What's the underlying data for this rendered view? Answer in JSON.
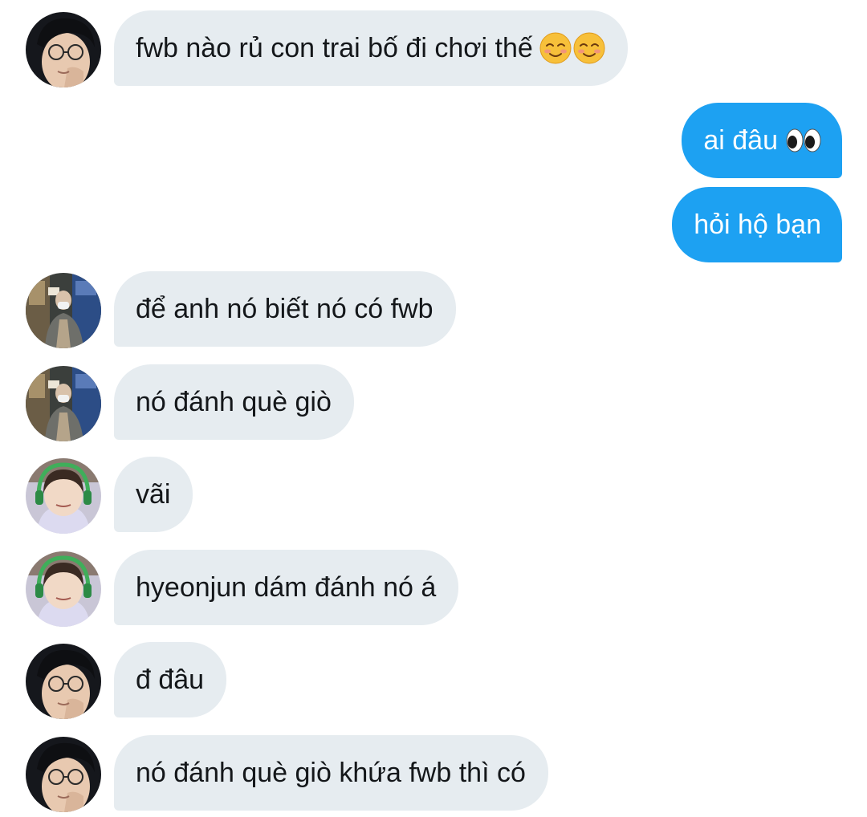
{
  "conversation": {
    "messages": [
      {
        "side": "in",
        "text": "fwb nào rủ con trai bố đi chơi thế",
        "emoji": [
          "smiling-face-icon",
          "smiling-face-icon"
        ],
        "avatar": "avatar-glasses"
      },
      {
        "side": "out",
        "text": "ai đâu",
        "emoji": [
          "eyes-icon"
        ]
      },
      {
        "side": "out",
        "text": "hỏi hộ bạn"
      },
      {
        "side": "in",
        "text": "để anh nó biết nó có fwb",
        "avatar": "avatar-mask-store"
      },
      {
        "side": "in",
        "text": "nó đánh què giò",
        "avatar": "avatar-mask-store"
      },
      {
        "side": "in",
        "text": "vãi",
        "avatar": "avatar-headset"
      },
      {
        "side": "in",
        "text": "hyeonjun dám đánh nó á",
        "avatar": "avatar-headset"
      },
      {
        "side": "in",
        "text": "đ đâu",
        "avatar": "avatar-glasses"
      },
      {
        "side": "in",
        "text": "nó đánh què giò khứa fwb thì có",
        "avatar": "avatar-glasses"
      }
    ]
  },
  "colors": {
    "incoming_bubble": "#e6ecf0",
    "outgoing_bubble": "#1da1f2",
    "incoming_text": "#14171a",
    "outgoing_text": "#ffffff",
    "background": "#ffffff"
  }
}
